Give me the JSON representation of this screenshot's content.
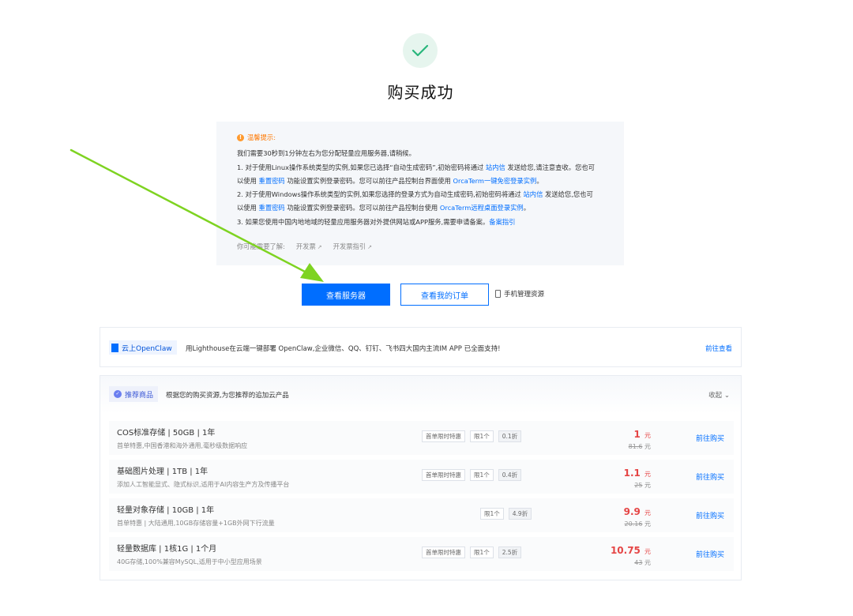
{
  "page_title": "购买成功",
  "tips": {
    "header": "温馨提示:",
    "line1": "我们需要30秒到1分钟左右为您分配轻量应用服务器,请稍候。",
    "line2_a": "1. 对于使用Linux操作系统类型的实例,如果您已选择“自动生成密码”,初始密码将通过 ",
    "line2_link": "站内信",
    "line2_b": " 发送给您,请注意查收。您也可",
    "line3_a": "以使用 ",
    "line3_link1": "重置密码",
    "line3_b": " 功能设置实例登录密码。您可以前往产品控制台界面使用 ",
    "line3_link2": "OrcaTerm一键免密登录实例",
    "line3_c": "。",
    "line4_a": "2. 对于使用Windows操作系统类型的实例,如果您选择的登录方式为自动生成密码,初始密码将通过 ",
    "line4_link": "站内信",
    "line4_b": " 发送给您,您也可",
    "line5_a": "以使用 ",
    "line5_link1": "重置密码",
    "line5_b": " 功能设置实例登录密码。您可以前往产品控制台使用 ",
    "line5_link2": "OrcaTerm远程桌面登录实例",
    "line5_c": "。",
    "line6_a": "3. 如果您使用中国内地地域的轻量应用服务器对外提供网站或APP服务,需要申请备案。",
    "line6_link": "备案指引",
    "more_label": "你可能需要了解:",
    "more_link1": "开发票",
    "more_link2": "开发票指引"
  },
  "buttons": {
    "view_server": "查看服务器",
    "view_orders": "查看我的订单",
    "mobile_manage": "手机管理资源"
  },
  "openclaw": {
    "badge": "云上OpenClaw",
    "text": "用Lighthouse在云端一键部署 OpenClaw,企业微信、QQ、钉钉、飞书四大国内主流IM APP 已全面支持!",
    "link": "前往查看"
  },
  "recommend": {
    "badge": "推荐商品",
    "subtitle": "根据您的购买资源,为您推荐的追加云产品",
    "collapse": "收起"
  },
  "products": [
    {
      "name": "COS标准存储 | 50GB | 1年",
      "desc": "首单特惠,中国香港和海外通用,毫秒级数据响应",
      "tag_first": "首单限时特惠",
      "tag_limit": "限1个",
      "tag_discount": "0.1折",
      "price": "1",
      "unit": "元",
      "old_price": "81.6",
      "old_unit": "元",
      "buy": "前往购买"
    },
    {
      "name": "基础图片处理 | 1TB | 1年",
      "desc": "添加人工智能显式、隐式标识,适用于AI内容生产方及传播平台",
      "tag_first": "首单限时特惠",
      "tag_limit": "限1个",
      "tag_discount": "0.4折",
      "price": "1.1",
      "unit": "元",
      "old_price": "25",
      "old_unit": "元",
      "buy": "前往购买"
    },
    {
      "name": "轻量对象存储 | 10GB | 1年",
      "desc": "首单特惠 | 大陆通用,10GB存储容量+1GB外网下行流量",
      "tag_first": "",
      "tag_limit": "限1个",
      "tag_discount": "4.9折",
      "price": "9.9",
      "unit": "元",
      "old_price": "20.16",
      "old_unit": "元",
      "buy": "前往购买"
    },
    {
      "name": "轻量数据库 | 1核1G | 1个月",
      "desc": "40G存储,100%兼容MySQL,适用于中小型应用场景",
      "tag_first": "首单限时特惠",
      "tag_limit": "限1个",
      "tag_discount": "2.5折",
      "price": "10.75",
      "unit": "元",
      "old_price": "43",
      "old_unit": "元",
      "buy": "前往购买"
    }
  ],
  "colors": {
    "primary": "#006eff",
    "success": "#29b67c",
    "price_red": "#e54545",
    "arrow_green": "#7ed321"
  },
  "icons": {
    "success": "check-icon",
    "warning": "warning-icon",
    "external": "external-link-icon",
    "phone": "phone-icon"
  }
}
